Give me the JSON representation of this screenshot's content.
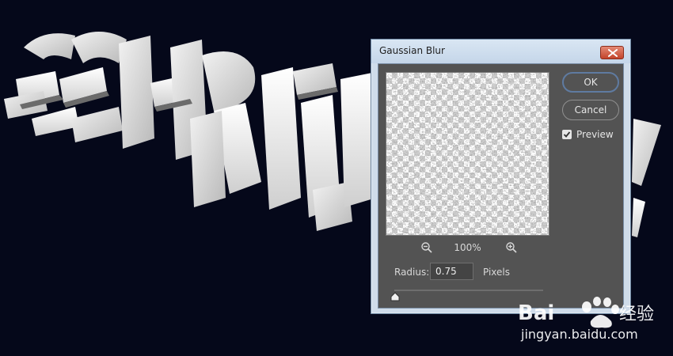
{
  "background": {
    "color": "#05081a",
    "artwork_text": "SCHRIFT"
  },
  "dialog": {
    "title": "Gaussian Blur",
    "close_icon": "close-icon",
    "ok_label": "OK",
    "cancel_label": "Cancel",
    "preview_label": "Preview",
    "preview_checked": true,
    "zoom_level": "100%",
    "zoom_out_icon": "zoom-out-icon",
    "zoom_in_icon": "zoom-in-icon",
    "radius_label": "Radius:",
    "radius_value": "0.75",
    "units_label": "Pixels",
    "slider_value": 0.75
  },
  "watermark": {
    "brand": "Bai",
    "brand_suffix": "经验",
    "url": "jingyan.baidu.com"
  }
}
